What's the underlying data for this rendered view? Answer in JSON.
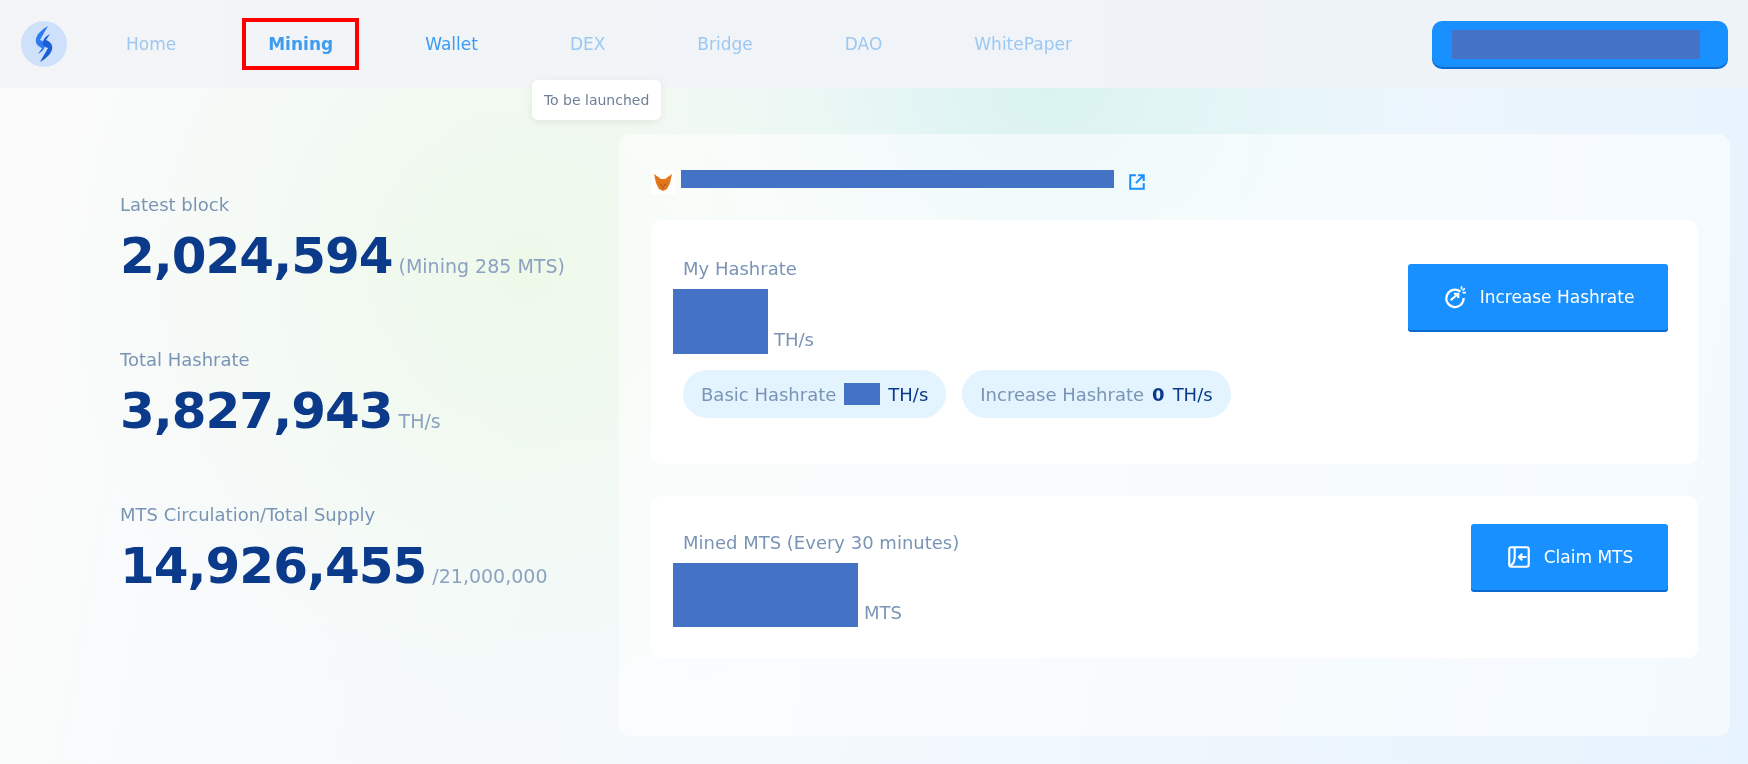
{
  "nav": {
    "items": [
      {
        "label": "Home",
        "selected": false,
        "dimmed": true,
        "highlighted": false
      },
      {
        "label": "Mining",
        "selected": true,
        "dimmed": false,
        "highlighted": true
      },
      {
        "label": "Wallet",
        "selected": false,
        "dimmed": false,
        "highlighted": false
      },
      {
        "label": "DEX",
        "selected": false,
        "dimmed": true,
        "highlighted": false
      },
      {
        "label": "Bridge",
        "selected": false,
        "dimmed": true,
        "highlighted": false
      },
      {
        "label": "DAO",
        "selected": false,
        "dimmed": true,
        "highlighted": false
      },
      {
        "label": "WhitePaper",
        "selected": false,
        "dimmed": true,
        "highlighted": false
      }
    ],
    "tooltip": "To be launched"
  },
  "stats": [
    {
      "label": "Latest block",
      "value": "2,024,594",
      "suffix": "(Mining 285 MTS)"
    },
    {
      "label": "Total Hashrate",
      "value": "3,827,943",
      "suffix": "TH/s"
    },
    {
      "label": "MTS Circulation/Total Supply",
      "value": "14,926,455",
      "suffix": "/21,000,000"
    }
  ],
  "hashrate_card": {
    "title": "My Hashrate",
    "unit": "TH/s",
    "button": "Increase Hashrate",
    "chips": [
      {
        "label": "Basic Hashrate",
        "value_redacted": true,
        "unit": "TH/s"
      },
      {
        "label": "Increase Hashrate",
        "value": "0",
        "unit": "TH/s"
      }
    ]
  },
  "mined_card": {
    "title": "Mined MTS (Every 30 minutes)",
    "unit": "MTS",
    "button": "Claim MTS"
  }
}
